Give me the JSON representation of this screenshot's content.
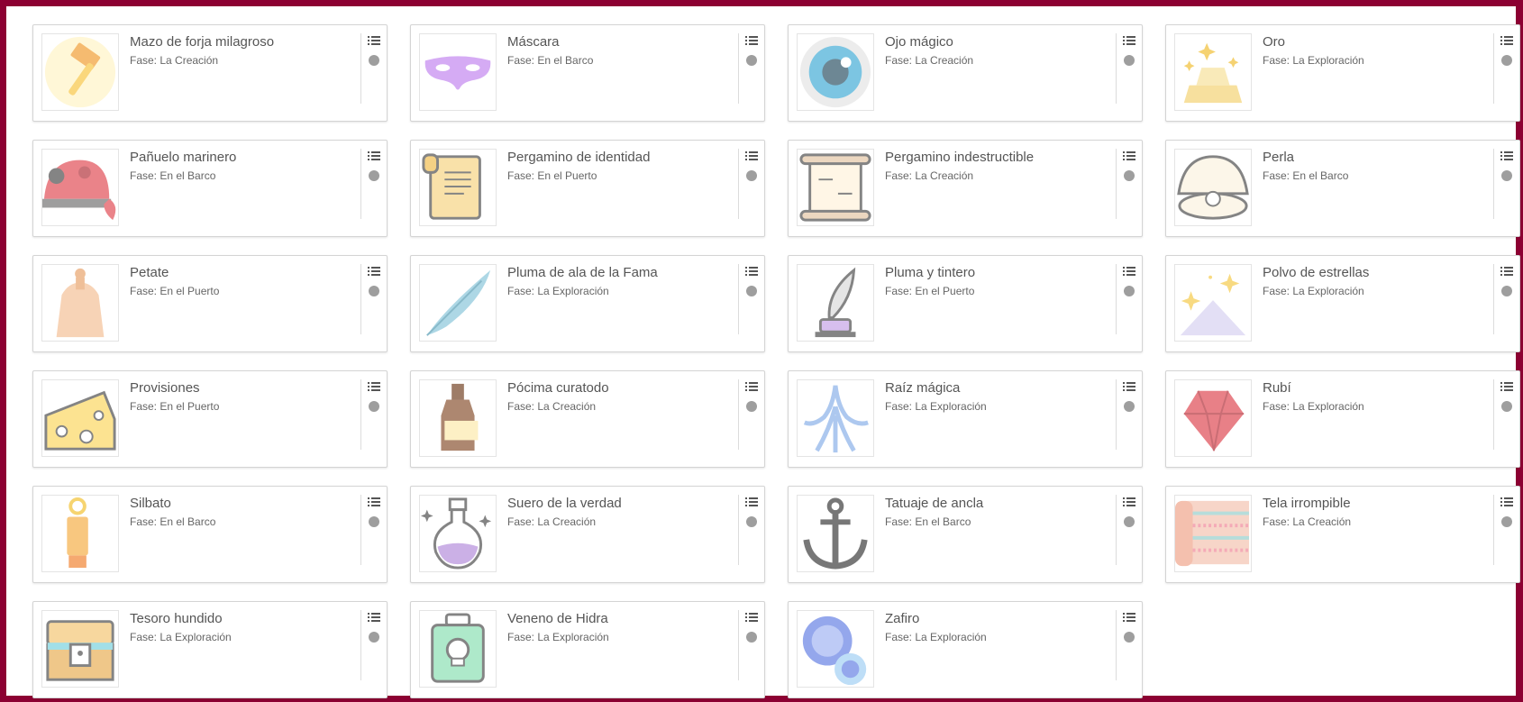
{
  "items": [
    {
      "name": "Mazo de forja milagroso",
      "phase": "Fase: La Creación",
      "icon": "hammer-icon"
    },
    {
      "name": "Máscara",
      "phase": "Fase: En el Barco",
      "icon": "mask-icon"
    },
    {
      "name": "Ojo mágico",
      "phase": "Fase: La Creación",
      "icon": "eye-icon"
    },
    {
      "name": "Oro",
      "phase": "Fase: La Exploración",
      "icon": "gold-bars-icon"
    },
    {
      "name": "Pañuelo marinero",
      "phase": "Fase: En el Barco",
      "icon": "bandana-icon"
    },
    {
      "name": "Pergamino de identidad",
      "phase": "Fase: En el Puerto",
      "icon": "identity-scroll-icon"
    },
    {
      "name": "Pergamino indestructible",
      "phase": "Fase: La Creación",
      "icon": "open-scroll-icon"
    },
    {
      "name": "Perla",
      "phase": "Fase: En el Barco",
      "icon": "pearl-icon"
    },
    {
      "name": "Petate",
      "phase": "Fase: En el Puerto",
      "icon": "sack-icon"
    },
    {
      "name": "Pluma de ala de la Fama",
      "phase": "Fase: La Exploración",
      "icon": "feather-icon"
    },
    {
      "name": "Pluma y tintero",
      "phase": "Fase: En el Puerto",
      "icon": "quill-ink-icon"
    },
    {
      "name": "Polvo de estrellas",
      "phase": "Fase: La Exploración",
      "icon": "stardust-icon"
    },
    {
      "name": "Provisiones",
      "phase": "Fase: En el Puerto",
      "icon": "cheese-icon"
    },
    {
      "name": "Pócima curatodo",
      "phase": "Fase: La Creación",
      "icon": "bottle-icon"
    },
    {
      "name": "Raíz mágica",
      "phase": "Fase: La Exploración",
      "icon": "root-icon"
    },
    {
      "name": "Rubí",
      "phase": "Fase: La Exploración",
      "icon": "ruby-icon"
    },
    {
      "name": "Silbato",
      "phase": "Fase: En el Barco",
      "icon": "whistle-icon"
    },
    {
      "name": "Suero de la verdad",
      "phase": "Fase: La Creación",
      "icon": "potion-icon"
    },
    {
      "name": "Tatuaje de ancla",
      "phase": "Fase: En el Barco",
      "icon": "anchor-icon"
    },
    {
      "name": "Tela irrompible",
      "phase": "Fase: La Creación",
      "icon": "fabric-icon"
    },
    {
      "name": "Tesoro hundido",
      "phase": "Fase: La Exploración",
      "icon": "treasure-chest-icon"
    },
    {
      "name": "Veneno de Hidra",
      "phase": "Fase: La Exploración",
      "icon": "poison-icon"
    },
    {
      "name": "Zafiro",
      "phase": "Fase: La Exploración",
      "icon": "sapphire-icon"
    }
  ],
  "colors": {
    "frame": "#8c0032",
    "card_border": "#d4d4d4",
    "status_dot": "#9e9e9e",
    "text": "#555555"
  }
}
